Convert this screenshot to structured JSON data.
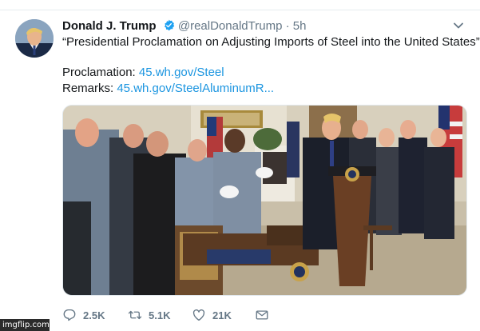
{
  "tweet": {
    "author_name": "Donald J. Trump",
    "handle": "@realDonaldTrump",
    "separator": "·",
    "time": "5h",
    "lines": {
      "quote": "“Presidential Proclamation on Adjusting Imports of Steel into the United States”",
      "proclamation_label": "Proclamation: ",
      "proclamation_link": "45.wh.gov/Steel",
      "remarks_label": "Remarks: ",
      "remarks_link": "45.wh.gov/SteelAluminumR..."
    },
    "icons": {
      "verified": "verified-badge-icon",
      "menu": "chevron-down-icon"
    }
  },
  "actions": {
    "reply_count": "2.5K",
    "retweet_count": "5.1K",
    "like_count": "21K"
  },
  "watermark": "imgflip.com",
  "colors": {
    "link": "#1b95e0",
    "text": "#14171a",
    "muted": "#657786",
    "verified": "#1da1f2"
  }
}
